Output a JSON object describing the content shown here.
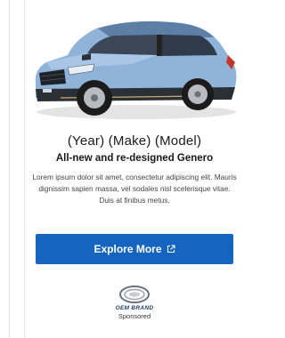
{
  "ad": {
    "title": "(Year) (Make) (Model)",
    "subtitle": "All-new and re-designed Genero",
    "body": "Lorem ipsum dolor sit amet, consectetur adipiscing elit. Mauris dignissim sapien massa, vel sodales nisl scelerisque vitae. Duis at finibus metus.",
    "cta_label": "Explore More",
    "cta_icon": "external-link-icon",
    "brand_name": "OEM BRAND",
    "sponsored_label": "Sponsored",
    "image": "suv-car-image"
  },
  "colors": {
    "cta_background": "#1565c0",
    "car_body": "#8fb3d9",
    "brand_text": "#1f3f6e"
  }
}
